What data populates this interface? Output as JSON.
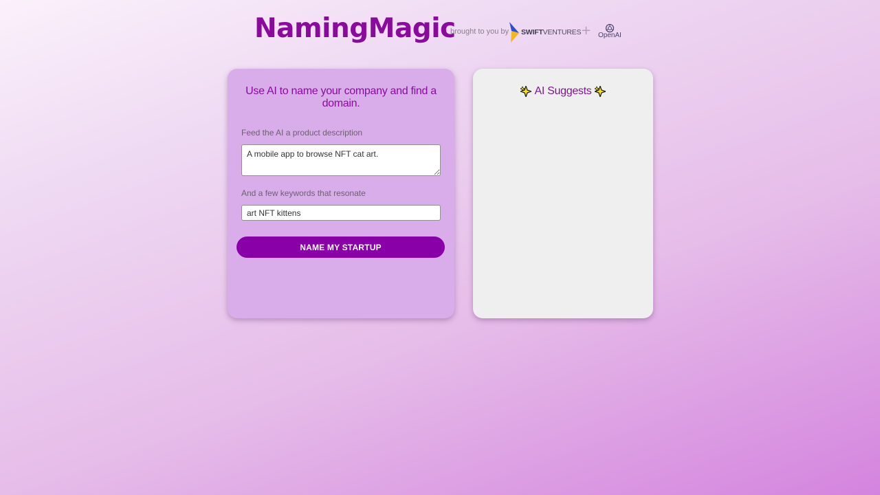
{
  "header": {
    "title": "NamingMagic",
    "brought_by": "brought to you by",
    "swift_logo": {
      "bold": "SWIFT",
      "rest": "VENTURES",
      "icon": "swift-arrow-icon"
    },
    "plus": "+",
    "openai_logo": {
      "label": "OpenAI",
      "icon": "openai-knot-icon"
    }
  },
  "form": {
    "heading": "Use AI to name your company and find a domain.",
    "description_label": "Feed the AI a product description",
    "description_value": "A mobile app to browse NFT cat art.",
    "keywords_label": "And a few keywords that resonate",
    "keywords_value": "art NFT kittens",
    "submit_label": "NAME MY STARTUP"
  },
  "results": {
    "heading": "AI Suggests",
    "icon": "sparkles-icon"
  },
  "colors": {
    "accent": "#8a00a8",
    "form_card": "#d8ade9",
    "results_card": "#efefef"
  }
}
